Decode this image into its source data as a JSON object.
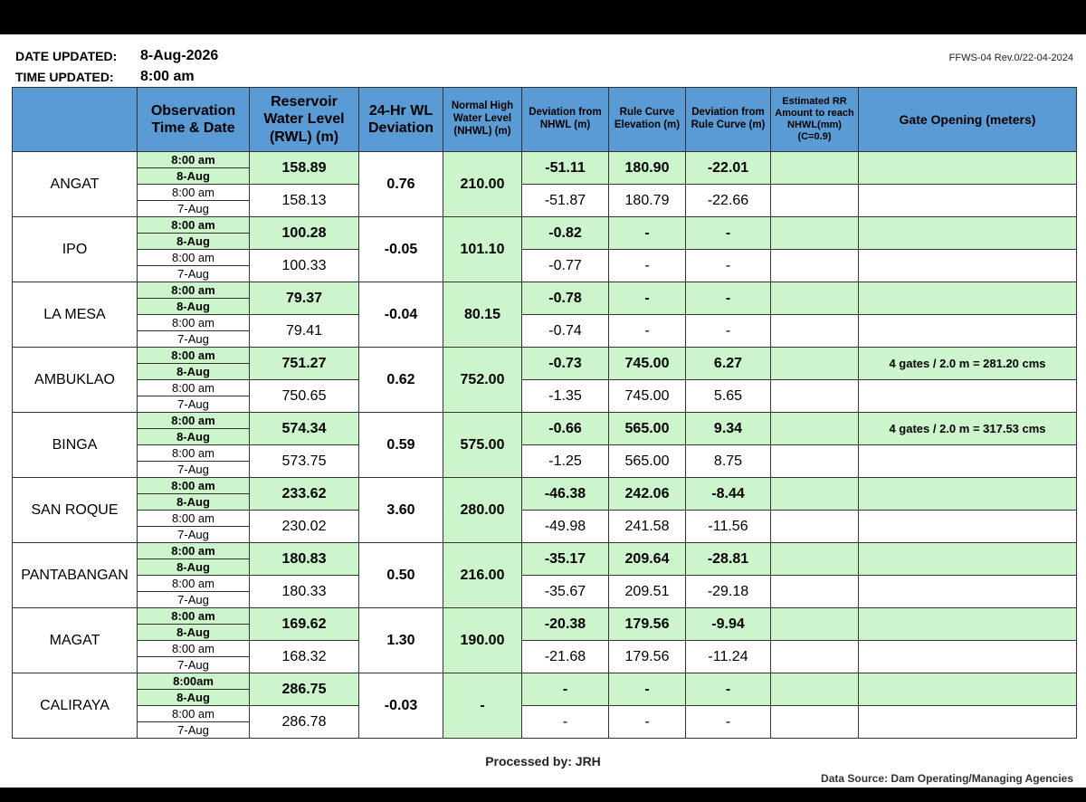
{
  "header": {
    "date_label": "DATE UPDATED:",
    "date_value": "8-Aug-2026",
    "time_label": "TIME UPDATED:",
    "time_value": "8:00 am",
    "form_code": "FFWS-04 Rev.0/22-04-2024"
  },
  "columns": {
    "observation": "Observation Time & Date",
    "rwl": "Reservoir Water Level (RWL) (m)",
    "deviation_24h": "24-Hr WL Deviation",
    "nhwl": "Normal High Water Level (NHWL) (m)",
    "dev_nhwl": "Deviation from NHWL (m)",
    "rule_curve": "Rule Curve Elevation (m)",
    "dev_rule": "Deviation from Rule Curve (m)",
    "rr_amount": "Estimated RR Amount to reach NHWL(mm) (C=0.9)",
    "gate": "Gate Opening (meters)"
  },
  "dams": [
    {
      "name": "ANGAT",
      "deviation": "0.76",
      "nhwl": "210.00",
      "deviation_bold": true,
      "rows": [
        {
          "time": "8:00 am",
          "date": "8-Aug",
          "rwl": "158.89",
          "dev_nhwl": "-51.11",
          "rule": "180.90",
          "dev_rule": "-22.01",
          "rr": "",
          "gate": ""
        },
        {
          "time": "8:00 am",
          "date": "7-Aug",
          "rwl": "158.13",
          "dev_nhwl": "-51.87",
          "rule": "180.79",
          "dev_rule": "-22.66",
          "rr": "",
          "gate": ""
        }
      ]
    },
    {
      "name": "IPO",
      "deviation": "-0.05",
      "nhwl": "101.10",
      "deviation_bold": true,
      "rows": [
        {
          "time": "8:00 am",
          "date": "8-Aug",
          "rwl": "100.28",
          "dev_nhwl": "-0.82",
          "rule": "-",
          "dev_rule": "-",
          "rr": "",
          "gate": ""
        },
        {
          "time": "8:00 am",
          "date": "7-Aug",
          "rwl": "100.33",
          "dev_nhwl": "-0.77",
          "rule": "-",
          "dev_rule": "-",
          "rr": "",
          "gate": ""
        }
      ]
    },
    {
      "name": "LA MESA",
      "deviation": "-0.04",
      "nhwl": "80.15",
      "deviation_bold": true,
      "rows": [
        {
          "time": "8:00 am",
          "date": "8-Aug",
          "rwl": "79.37",
          "dev_nhwl": "-0.78",
          "rule": "-",
          "dev_rule": "-",
          "rr": "",
          "gate": ""
        },
        {
          "time": "8:00 am",
          "date": "7-Aug",
          "rwl": "79.41",
          "dev_nhwl": "-0.74",
          "rule": "-",
          "dev_rule": "-",
          "rr": "",
          "gate": ""
        }
      ]
    },
    {
      "name": "AMBUKLAO",
      "deviation": "0.62",
      "nhwl": "752.00",
      "deviation_bold": true,
      "rows": [
        {
          "time": "8:00 am",
          "date": "8-Aug",
          "rwl": "751.27",
          "dev_nhwl": "-0.73",
          "rule": "745.00",
          "dev_rule": "6.27",
          "rr": "",
          "gate": "4 gates / 2.0 m = 281.20 cms"
        },
        {
          "time": "8:00 am",
          "date": "7-Aug",
          "rwl": "750.65",
          "dev_nhwl": "-1.35",
          "rule": "745.00",
          "dev_rule": "5.65",
          "rr": "",
          "gate": ""
        }
      ]
    },
    {
      "name": "BINGA",
      "deviation": "0.59",
      "nhwl": "575.00",
      "deviation_bold": true,
      "rows": [
        {
          "time": "8:00 am",
          "date": "8-Aug",
          "rwl": "574.34",
          "dev_nhwl": "-0.66",
          "rule": "565.00",
          "dev_rule": "9.34",
          "rr": "",
          "gate": "4 gates / 2.0 m = 317.53 cms"
        },
        {
          "time": "8:00 am",
          "date": "7-Aug",
          "rwl": "573.75",
          "dev_nhwl": "-1.25",
          "rule": "565.00",
          "dev_rule": "8.75",
          "rr": "",
          "gate": ""
        }
      ]
    },
    {
      "name": "SAN ROQUE",
      "deviation": "3.60",
      "nhwl": "280.00",
      "deviation_bold": true,
      "rows": [
        {
          "time": "8:00 am",
          "date": "8-Aug",
          "rwl": "233.62",
          "dev_nhwl": "-46.38",
          "rule": "242.06",
          "dev_rule": "-8.44",
          "rr": "",
          "gate": ""
        },
        {
          "time": "8:00 am",
          "date": "7-Aug",
          "rwl": "230.02",
          "dev_nhwl": "-49.98",
          "rule": "241.58",
          "dev_rule": "-11.56",
          "rr": "",
          "gate": ""
        }
      ]
    },
    {
      "name": "PANTABANGAN",
      "deviation": "0.50",
      "nhwl": "216.00",
      "deviation_bold": true,
      "rows": [
        {
          "time": "8:00 am",
          "date": "8-Aug",
          "rwl": "180.83",
          "dev_nhwl": "-35.17",
          "rule": "209.64",
          "dev_rule": "-28.81",
          "rr": "",
          "gate": ""
        },
        {
          "time": "8:00 am",
          "date": "7-Aug",
          "rwl": "180.33",
          "dev_nhwl": "-35.67",
          "rule": "209.51",
          "dev_rule": "-29.18",
          "rr": "",
          "gate": ""
        }
      ]
    },
    {
      "name": "MAGAT",
      "deviation": "1.30",
      "nhwl": "190.00",
      "deviation_bold": true,
      "rows": [
        {
          "time": "8:00 am",
          "date": "8-Aug",
          "rwl": "169.62",
          "dev_nhwl": "-20.38",
          "rule": "179.56",
          "dev_rule": "-9.94",
          "rr": "",
          "gate": ""
        },
        {
          "time": "8:00 am",
          "date": "7-Aug",
          "rwl": "168.32",
          "dev_nhwl": "-21.68",
          "rule": "179.56",
          "dev_rule": "-11.24",
          "rr": "",
          "gate": ""
        }
      ]
    },
    {
      "name": "CALIRAYA",
      "deviation": "-0.03",
      "nhwl": "-",
      "deviation_bold": true,
      "rows": [
        {
          "time": "8:00am",
          "date": "8-Aug",
          "rwl": "286.75",
          "dev_nhwl": "-",
          "rule": "-",
          "dev_rule": "-",
          "rr": "",
          "gate": ""
        },
        {
          "time": "8:00 am",
          "date": "7-Aug",
          "rwl": "286.78",
          "dev_nhwl": "-",
          "rule": "-",
          "dev_rule": "-",
          "rr": "",
          "gate": ""
        }
      ]
    }
  ],
  "footer": {
    "processed_by": "Processed by: JRH",
    "data_source": "Data Source: Dam Operating/Managing Agencies"
  },
  "colors": {
    "header_blue": "#5b9bd5",
    "current_green": "#ccf5cc"
  }
}
